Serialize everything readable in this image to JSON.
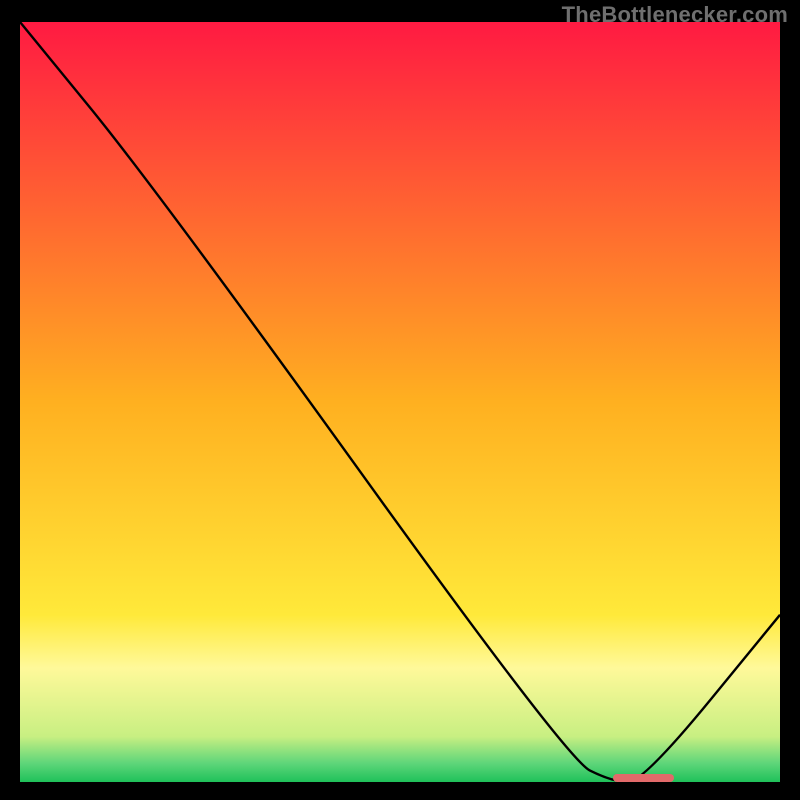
{
  "watermark": "TheBottlenecker.com",
  "chart_data": {
    "type": "line",
    "title": "",
    "xlabel": "",
    "ylabel": "",
    "xlim": [
      0,
      100
    ],
    "ylim": [
      0,
      100
    ],
    "grid": false,
    "curve_points_xy": [
      [
        0,
        100
      ],
      [
        18,
        78
      ],
      [
        72,
        3
      ],
      [
        78,
        0
      ],
      [
        82,
        0
      ],
      [
        100,
        22
      ]
    ],
    "optimal_zone": {
      "x_start": 78,
      "x_end": 86,
      "y": 0
    },
    "background": {
      "gradient_stops": [
        {
          "pos": 0.0,
          "color": "#ff1a42"
        },
        {
          "pos": 0.5,
          "color": "#ffb020"
        },
        {
          "pos": 0.78,
          "color": "#ffe93a"
        },
        {
          "pos": 0.85,
          "color": "#fff99a"
        },
        {
          "pos": 0.94,
          "color": "#c8ef82"
        },
        {
          "pos": 0.975,
          "color": "#5fd67a"
        },
        {
          "pos": 1.0,
          "color": "#1fc15a"
        }
      ]
    },
    "curve_color": "#000000",
    "curve_width": 2.4
  }
}
